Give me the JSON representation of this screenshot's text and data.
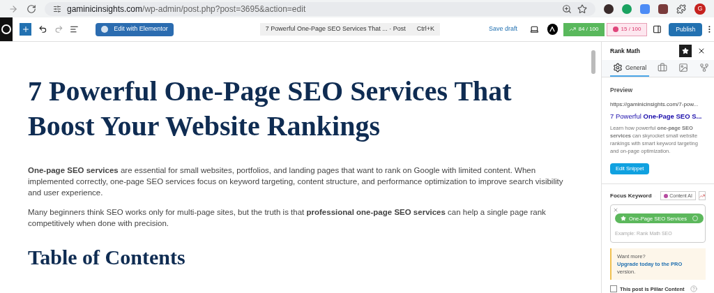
{
  "browser": {
    "url_host": "gaminicinsights.com",
    "url_path": "/wp-admin/post.php?post=3695&action=edit",
    "profile_letter": "G"
  },
  "toolbar": {
    "edit_button": "Edit with Elementor",
    "document_title": "7 Powerful One-Page SEO Services That ... · Post",
    "shortcut": "Ctrl+K",
    "save_draft": "Save draft",
    "seo_score": "84 / 100",
    "readability_score": "15 / 100",
    "publish": "Publish"
  },
  "post": {
    "title": "7 Powerful One-Page SEO Services That Boost Your Website Rankings",
    "paragraphs": [
      "**One-page SEO services** are essential for small websites, portfolios, and landing pages that want to rank on Google with limited content. When implemented correctly, one-page SEO services focus on keyword targeting, content structure, and performance optimization to improve search visibility and user experience.",
      "Many beginners think SEO works only for multi-page sites, but the truth is that **professional one-page SEO services** can help a single page rank competitively when done with precision."
    ],
    "heading": "Table of Contents"
  },
  "sidebar": {
    "title": "Rank Math",
    "tabs": [
      {
        "kind": "general",
        "label": "General",
        "selected": true
      },
      {
        "kind": "schema",
        "selected": false
      },
      {
        "kind": "social",
        "selected": false
      },
      {
        "kind": "advanced",
        "selected": false
      }
    ],
    "preview": {
      "label": "Preview",
      "url": "https://gaminicinsights.com/7-pow...",
      "title": "7 Powerful **One-Page SEO S...**",
      "description": "Learn how powerful **one-page SEO services** can skyrocket small website rankings with smart keyword targeting and on-page optimization."
    },
    "edit_snippet": "Edit Snippet",
    "focus_keyword": {
      "label": "Focus Keyword",
      "content_ai": "Content AI",
      "keyword": "One-Page SEO Services",
      "placeholder": "Example: Rank Math SEO"
    },
    "notice": {
      "before": "Want more?",
      "link": "Upgrade today to the PRO",
      "after": "version."
    },
    "pillar": {
      "label": "This post is Pillar Content",
      "checked": false
    }
  }
}
